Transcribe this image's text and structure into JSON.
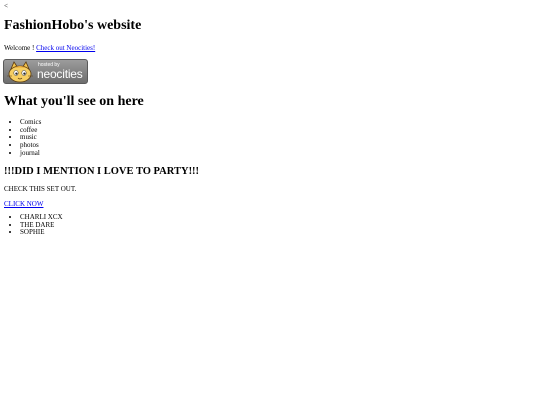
{
  "stray_text": "<",
  "title": "FashionHobo's website",
  "welcome": {
    "text": "Welcome ! ",
    "link_label": "Check out Neocities!"
  },
  "badge": {
    "line1": "hosted by",
    "line2": "neocities",
    "icon": "neocities-cat-icon",
    "colors": {
      "background": "#8a8a8a",
      "text": "#ffffff"
    }
  },
  "section_heading": "What you'll see on here",
  "topics": [
    "Comics",
    "coffee",
    "music",
    "photos",
    "journal"
  ],
  "party_heading": "!!!DID I MENTION I LOVE TO PARTY!!!",
  "check_text": "CHECK THIS SET OUT.",
  "click_label": "CLICK NOW",
  "artists": [
    "CHARLI XCX",
    "THE DARE",
    "SOPHIE"
  ],
  "link_color": "#0000ee"
}
